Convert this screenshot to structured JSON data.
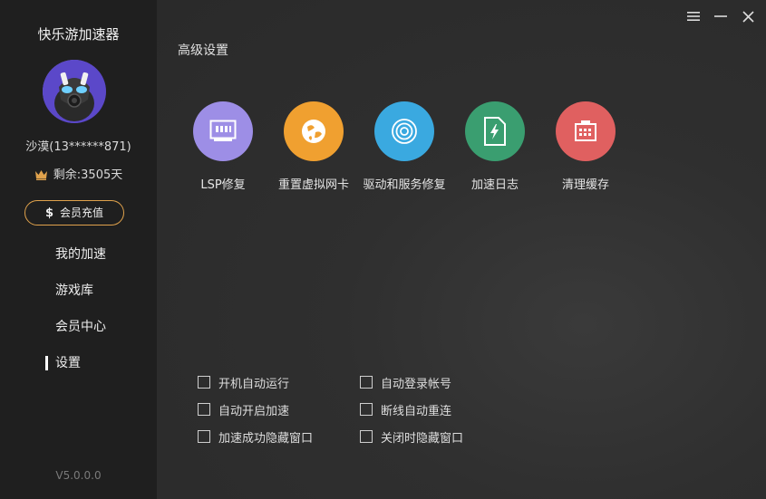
{
  "app": {
    "title": "快乐游加速器",
    "version": "V5.0.0.0"
  },
  "user": {
    "name": "沙漠(13******871)",
    "remaining": "剩余:3505天"
  },
  "recharge": {
    "icon": "$",
    "label": "会员充值"
  },
  "nav": [
    {
      "label": "我的加速",
      "active": false
    },
    {
      "label": "游戏库",
      "active": false
    },
    {
      "label": "会员中心",
      "active": false
    },
    {
      "label": "设置",
      "active": true
    }
  ],
  "main": {
    "section_title": "高级设置",
    "tools": [
      {
        "label": "LSP修复",
        "color": "#9d8ee6",
        "icon": "network-card-icon"
      },
      {
        "label": "重置虚拟网卡",
        "color": "#f0a030",
        "icon": "globe-icon"
      },
      {
        "label": "驱动和服务修复",
        "color": "#3aa9e0",
        "icon": "target-icon"
      },
      {
        "label": "加速日志",
        "color": "#3a9e70",
        "icon": "log-file-icon"
      },
      {
        "label": "清理缓存",
        "color": "#e06060",
        "icon": "clean-chip-icon"
      }
    ],
    "options_left": [
      {
        "label": "开机自动运行",
        "checked": false
      },
      {
        "label": "自动开启加速",
        "checked": false
      },
      {
        "label": "加速成功隐藏窗口",
        "checked": false
      }
    ],
    "options_right": [
      {
        "label": "自动登录帐号",
        "checked": false
      },
      {
        "label": "断线自动重连",
        "checked": false
      },
      {
        "label": "关闭时隐藏窗口",
        "checked": false
      }
    ]
  },
  "colors": {
    "sidebar_bg": "#1f1f1f",
    "main_bg": "#2c2c2c",
    "accent_gold": "#e0a24c"
  }
}
